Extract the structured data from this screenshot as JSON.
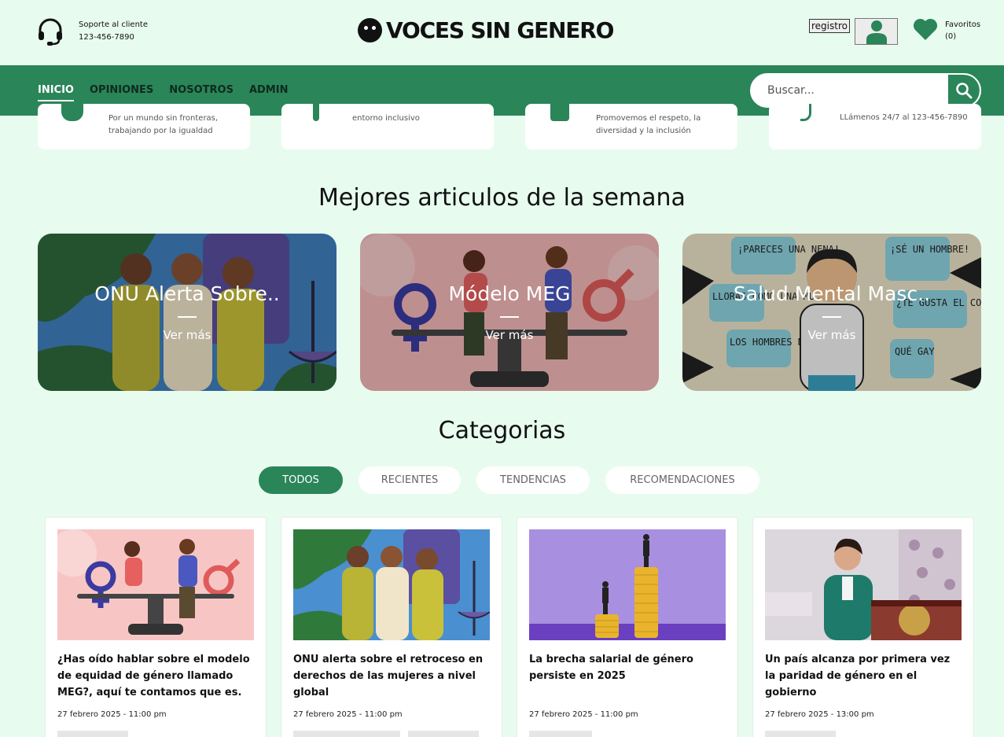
{
  "header": {
    "support_label": "Soporte al cliente",
    "support_phone": "123-456-7890",
    "brand_name": "VOCES SIN GENERO",
    "register_label": "registro",
    "favorites_label": "Favoritos",
    "favorites_count": "(0)"
  },
  "nav": {
    "items": [
      "INICIO",
      "OPINIONES",
      "NOSOTROS",
      "ADMIN"
    ],
    "active_index": 0
  },
  "search": {
    "placeholder": "Buscar..."
  },
  "features": [
    {
      "line1": "Por un mundo sin fronteras,",
      "line2": "trabajando por la igualdad"
    },
    {
      "line1": "",
      "line2": "entorno inclusivo"
    },
    {
      "line1": "Promovemos el respeto, la",
      "line2": "diversidad y la inclusión"
    },
    {
      "line1": "LLámenos 24/7 al 123-456-7890",
      "line2": ""
    }
  ],
  "top_articles": {
    "title": "Mejores articulos de la semana",
    "items": [
      {
        "title": "ONU Alerta Sobre..",
        "more": "Ver más"
      },
      {
        "title": "Módelo MEG",
        "more": "Ver más"
      },
      {
        "title": "Salud Mental Masc..",
        "more": "Ver más"
      }
    ],
    "speech_bubbles": [
      "¡PARECES UNA NENA!",
      "¡SÉ UN HOMBRE!",
      "LLORAS COMO UNA MUJER",
      "¿TE GUSTA EL COLOR ROSADO?",
      "LOS HOMBRES NO SUFRIMOS",
      "QUÉ GAY"
    ]
  },
  "categories": {
    "title": "Categorias",
    "tabs": [
      "TODOS",
      "RECIENTES",
      "TENDENCIAS",
      "RECOMENDACIONES"
    ],
    "active_index": 0
  },
  "posts": [
    {
      "title": "¿Has oído hablar sobre el modelo de equidad de género llamado MEG?, aquí te contamos que es.",
      "date": "27 febrero 2025 - 11:00 pm"
    },
    {
      "title": "ONU alerta sobre el retroceso en derechos de las mujeres a nivel global",
      "date": "27 febrero 2025 - 11:00 pm"
    },
    {
      "title": "La brecha salarial de género persiste en 2025",
      "date": "27 febrero 2025 - 11:00 pm"
    },
    {
      "title": "Un país alcanza por primera vez la paridad de género en el gobierno",
      "date": "27 febrero 2025 - 13:00 pm"
    }
  ],
  "colors": {
    "primary": "#2a8559",
    "background": "#e8fbef",
    "text": "#111111"
  }
}
